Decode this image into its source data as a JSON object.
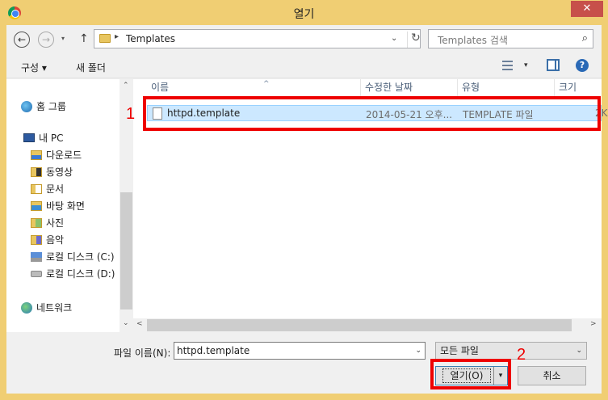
{
  "window": {
    "title": "열기",
    "close_glyph": "✕"
  },
  "navbar": {
    "back_glyph": "←",
    "forward_glyph": "→",
    "recent_glyph": "▾",
    "up_glyph": "↑",
    "breadcrumb_separator": "▸",
    "address": "Templates",
    "address_dropdown_glyph": "⌄",
    "refresh_glyph": "↻",
    "search_placeholder": "Templates 검색",
    "search_glyph": "⌕"
  },
  "toolbar": {
    "organize": "구성 ▾",
    "new_folder": "새 폴더",
    "view_dropdown_glyph": "▾",
    "help_glyph": "?"
  },
  "sidebar": {
    "items": [
      {
        "label": "홈 그룹",
        "icon": "homegroup-icon"
      },
      {
        "label": "내 PC",
        "icon": "pc-icon"
      },
      {
        "label": "다운로드",
        "icon": "downloads-folder-icon"
      },
      {
        "label": "동영상",
        "icon": "videos-folder-icon"
      },
      {
        "label": "문서",
        "icon": "documents-folder-icon"
      },
      {
        "label": "바탕 화면",
        "icon": "desktop-folder-icon"
      },
      {
        "label": "사진",
        "icon": "pictures-folder-icon"
      },
      {
        "label": "음악",
        "icon": "music-folder-icon"
      },
      {
        "label": "로컬 디스크 (C:)",
        "icon": "drive-c-icon"
      },
      {
        "label": "로컬 디스크 (D:)",
        "icon": "drive-d-icon"
      },
      {
        "label": "네트워크",
        "icon": "network-icon"
      }
    ],
    "scroll_up_glyph": "⌃",
    "scroll_down_glyph": "⌄"
  },
  "file_list": {
    "columns": [
      "이름",
      "수정한 날짜",
      "유형",
      "크기"
    ],
    "sort_glyph": "^",
    "rows": [
      {
        "name": "httpd.template",
        "modified": "2014-05-21 오후...",
        "type": "TEMPLATE 파일",
        "size": "2K"
      }
    ],
    "scroll_left_glyph": "<",
    "scroll_right_glyph": ">"
  },
  "footer": {
    "filename_label": "파일 이름(N):",
    "filename_value": "httpd.template",
    "filter_value": "모든 파일",
    "dropdown_glyph": "⌄",
    "open_button": "열기(O)",
    "open_split_glyph": "▾",
    "cancel_button": "취소"
  },
  "annotations": {
    "marker_1": "1",
    "marker_2": "2",
    "color": "#e00000"
  }
}
